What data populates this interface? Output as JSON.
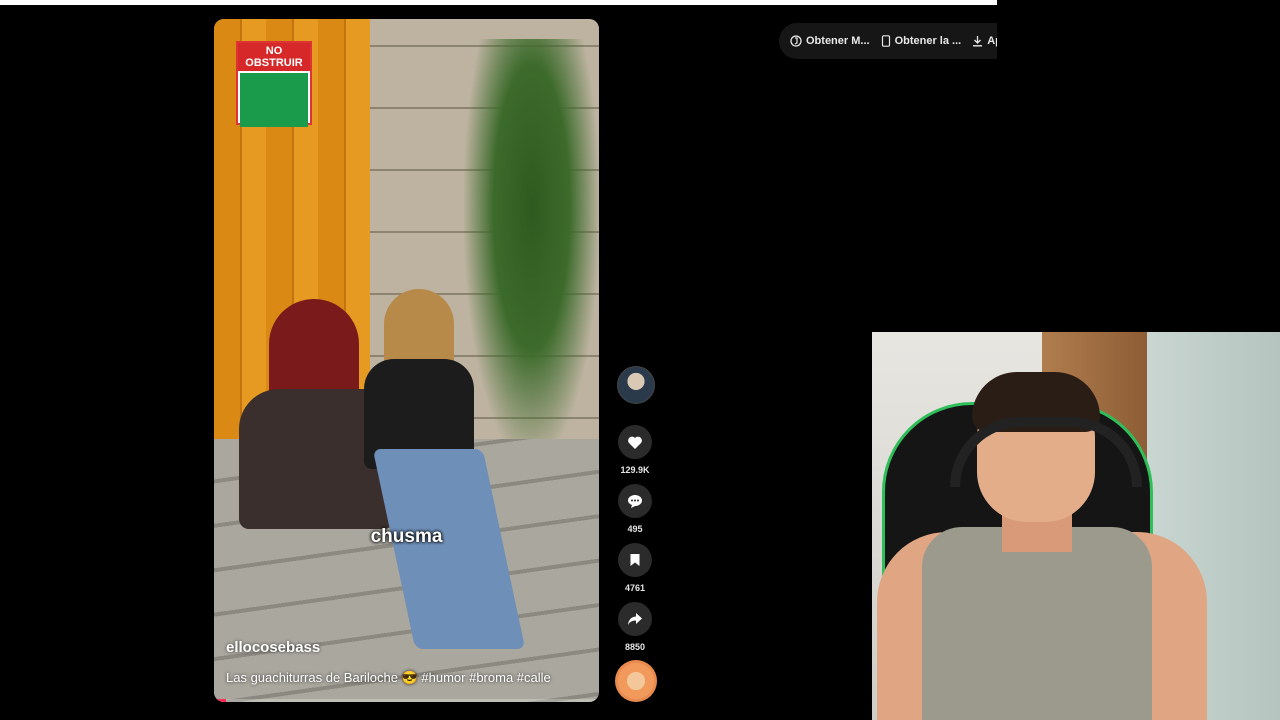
{
  "toolbar": {
    "items": [
      {
        "label": "Obtener M...",
        "icon": "tiktok-coin-icon"
      },
      {
        "label": "Obtener la ...",
        "icon": "phone-icon"
      },
      {
        "label": "Ap",
        "icon": "download-icon"
      }
    ]
  },
  "video": {
    "sign_text": "NO OBSTRUIR",
    "caption_word": "chusma",
    "username": "ellocosebass",
    "description": "Las guachiturras de Bariloche 😎 #humor #broma #calle",
    "progress_fraction": 0.03
  },
  "actions": {
    "likes": "129.9K",
    "comments": "495",
    "saves": "4761",
    "shares": "8850"
  },
  "colors": {
    "accent": "#fe2c55",
    "toolbar_bg": "#161616",
    "action_bg": "#2b2b2b",
    "chair_trim": "#2fbf5a"
  }
}
